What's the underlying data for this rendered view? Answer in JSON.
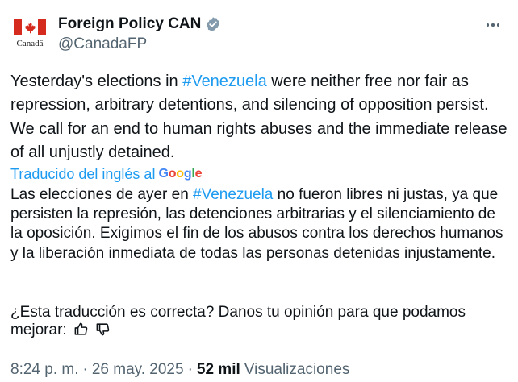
{
  "author": {
    "display_name": "Foreign Policy CAN",
    "handle": "@CanadaFP",
    "avatar_wordmark": "Canadä",
    "verified_icon": "verified-badge-icon"
  },
  "tweet": {
    "text_before_tag": "Yesterday's elections in ",
    "hashtag": "#Venezuela",
    "text_after_tag": " were neither free nor fair as repression, arbitrary detentions, and silencing of opposition persist. We call for an end to human rights abuses and the immediate release of all unjustly detained."
  },
  "translation": {
    "label": "Traducido del inglés al",
    "provider_logo": "Google",
    "text_before_tag": "Las elecciones de ayer en ",
    "hashtag": "#Venezuela",
    "text_after_tag": " no fueron libres ni justas, ya que persisten la represión, las detenciones arbitrarias y el silenciamiento de la oposición. Exigimos el fin de los abusos contra los derechos humanos y la liberación inmediata de todas las personas detenidas injustamente.",
    "feedback_prompt": "¿Esta traducción es correcta? Danos tu opinión para que podamos mejorar:"
  },
  "meta": {
    "time": "8:24 p. m.",
    "separator": "·",
    "date": "26 may. 2025",
    "views_count": "52 mil",
    "views_label": "Visualizaciones"
  },
  "colors": {
    "link": "#1d9bf0",
    "text": "#0f1419",
    "secondary": "#536471",
    "canada_red": "#d52b1e"
  }
}
